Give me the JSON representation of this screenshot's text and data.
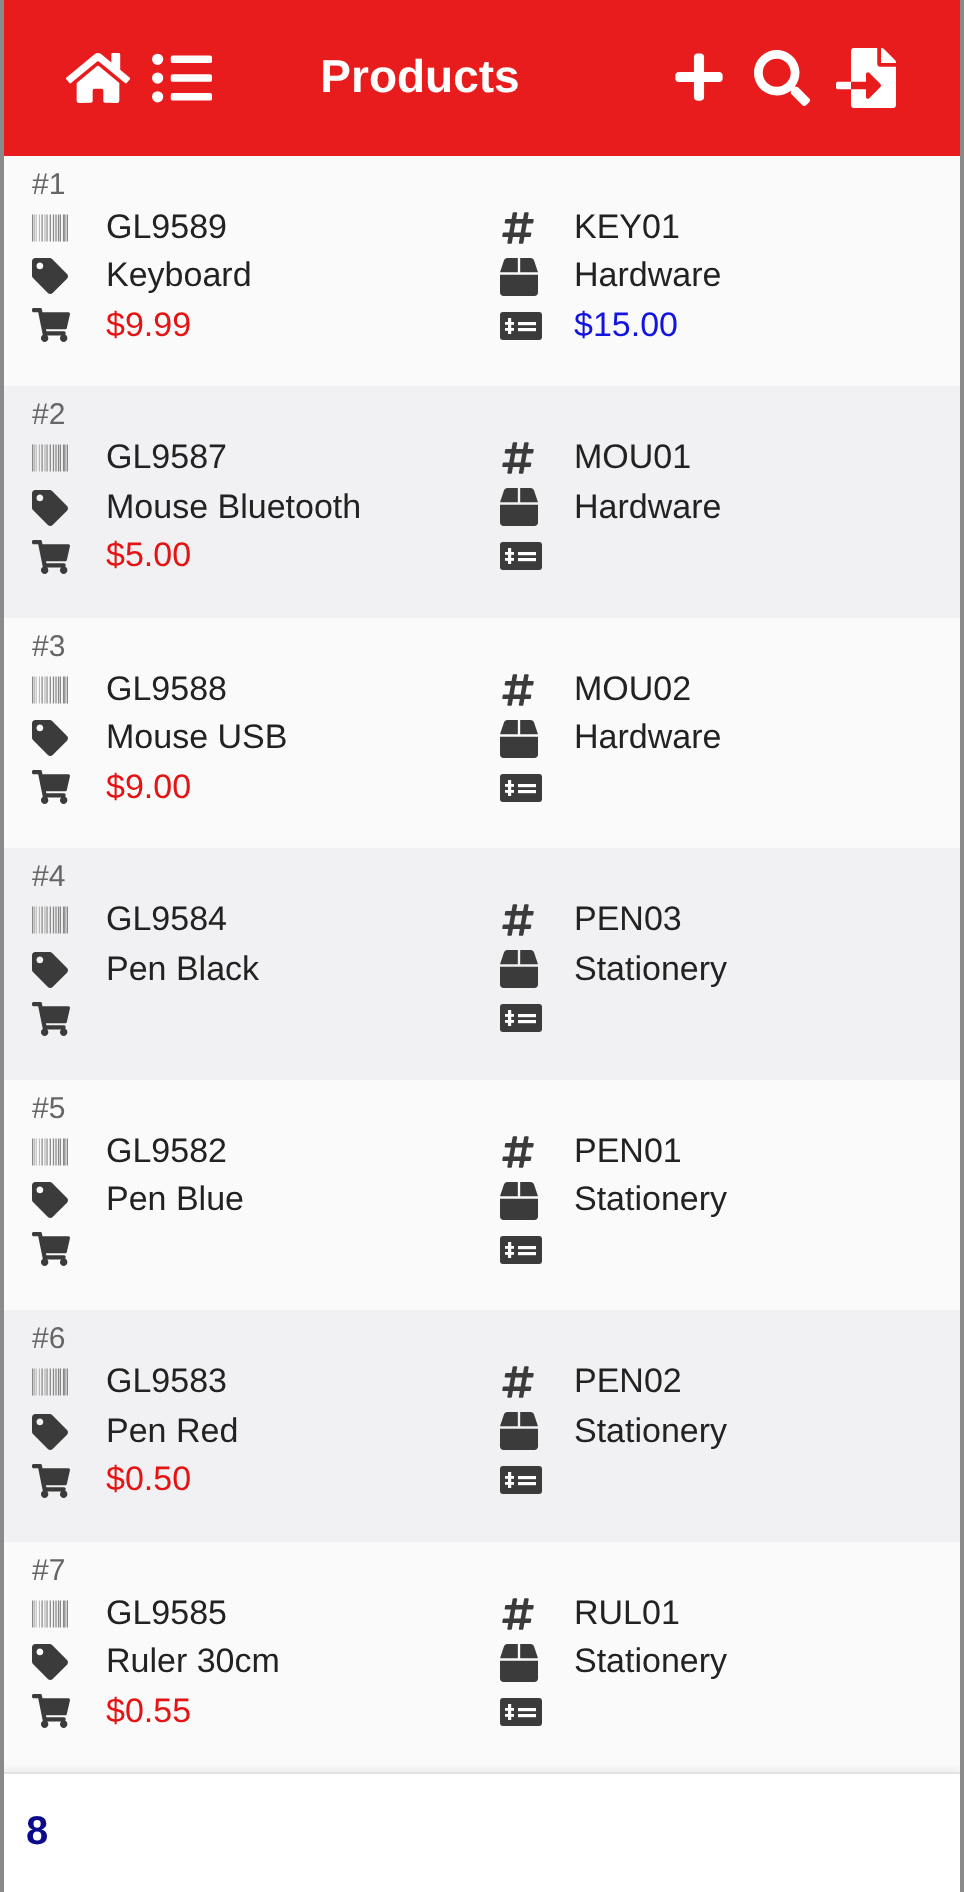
{
  "header": {
    "title": "Products"
  },
  "products": [
    {
      "index": "#1",
      "barcode": "GL9589",
      "name": "Keyboard",
      "price": "$9.99",
      "code": "KEY01",
      "category": "Hardware",
      "cost": "$15.00"
    },
    {
      "index": "#2",
      "barcode": "GL9587",
      "name": "Mouse Bluetooth",
      "price": "$5.00",
      "code": "MOU01",
      "category": "Hardware"
    },
    {
      "index": "#3",
      "barcode": "GL9588",
      "name": "Mouse USB",
      "price": "$9.00",
      "code": "MOU02",
      "category": "Hardware"
    },
    {
      "index": "#4",
      "barcode": "GL9584",
      "name": "Pen Black",
      "code": "PEN03",
      "category": "Stationery"
    },
    {
      "index": "#5",
      "barcode": "GL9582",
      "name": "Pen Blue",
      "code": "PEN01",
      "category": "Stationery"
    },
    {
      "index": "#6",
      "barcode": "GL9583",
      "name": "Pen Red",
      "price": "$0.50",
      "code": "PEN02",
      "category": "Stationery"
    },
    {
      "index": "#7",
      "barcode": "GL9585",
      "name": "Ruler 30cm",
      "price": "$0.55",
      "code": "RUL01",
      "category": "Stationery"
    }
  ],
  "footer": {
    "count": "8"
  }
}
